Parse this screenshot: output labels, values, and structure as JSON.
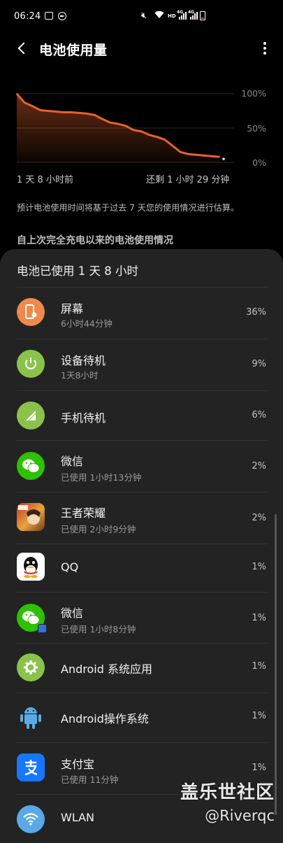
{
  "status_bar": {
    "time": "06:24",
    "hd": "HD",
    "net1": "4G",
    "net2": "4G"
  },
  "app_bar": {
    "title": "电池使用量"
  },
  "chart": {
    "y_labels": [
      "100%",
      "50%",
      "0%"
    ],
    "x_start_label": "1 天 8 小时前",
    "x_end_label": "还剩 1 小时 29 分钟",
    "accent": "#e8622a"
  },
  "chart_data": {
    "type": "area",
    "title": "",
    "xlabel": "",
    "ylabel": "",
    "ylim": [
      0,
      100
    ],
    "x_start": "1 天 8 小时前",
    "x_end": "还剩 1 小时 29 分钟",
    "series": [
      {
        "values": [
          100,
          87,
          82,
          76,
          75,
          74,
          73,
          73,
          72,
          71,
          69,
          63,
          58,
          56,
          53,
          47,
          45,
          40,
          37,
          33,
          24,
          15,
          12,
          11,
          10,
          9,
          8
        ]
      }
    ]
  },
  "estimate_note": "预计电池使用时间将基于过去 7 天您的使用情况进行估算。",
  "section_header": "自上次完全充电以来的电池使用情况",
  "sheet": {
    "title": "电池已使用 1 天 8 小时",
    "apps": [
      {
        "name": "屏幕",
        "sub": "6小时44分钟",
        "pct": "36%",
        "icon": "screen-icon"
      },
      {
        "name": "设备待机",
        "sub": "1天8小时",
        "pct": "9%",
        "icon": "power-icon"
      },
      {
        "name": "手机待机",
        "sub": "",
        "pct": "6%",
        "icon": "signal-icon"
      },
      {
        "name": "微信",
        "sub": "已使用 1小时13分钟",
        "pct": "2%",
        "icon": "wechat-icon"
      },
      {
        "name": "王者荣耀",
        "sub": "已使用 2小时9分钟",
        "pct": "2%",
        "icon": "game-icon"
      },
      {
        "name": "QQ",
        "sub": "",
        "pct": "1%",
        "icon": "qq-icon"
      },
      {
        "name": "微信",
        "sub": "已使用 1小时8分钟",
        "pct": "1%",
        "icon": "wechat-clone-icon"
      },
      {
        "name": "Android 系统应用",
        "sub": "",
        "pct": "1%",
        "icon": "android-settings-icon"
      },
      {
        "name": "Android操作系统",
        "sub": "",
        "pct": "1%",
        "icon": "android-icon"
      },
      {
        "name": "支付宝",
        "sub": "已使用 11分钟",
        "pct": "1%",
        "icon": "alipay-icon"
      },
      {
        "name": "WLAN",
        "sub": "",
        "pct": "",
        "icon": "wifi-icon"
      }
    ]
  },
  "watermark": {
    "line1": "盖乐世社区",
    "line2": "@Riverqc"
  }
}
